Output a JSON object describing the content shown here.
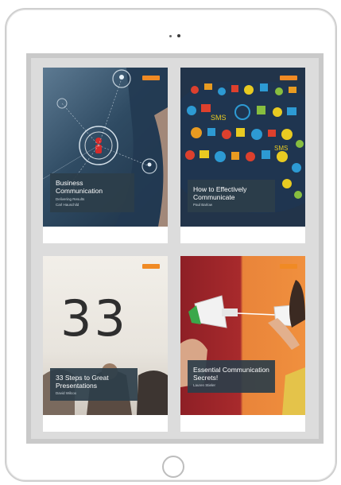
{
  "books": [
    {
      "title": "Business Communication",
      "subtitle": "Delivering Results",
      "author": "Carl Hauschild"
    },
    {
      "title": "How to Effectively Communicate",
      "subtitle": "",
      "author": "Paul Barlow"
    },
    {
      "title": "33 Steps to Great Presentations",
      "subtitle": "",
      "author": "David Wilcox"
    },
    {
      "title": "Essential Communication Secrets!",
      "subtitle": "",
      "author": "Lauren Stieler"
    }
  ],
  "cover_numbers": {
    "steps": "33"
  },
  "colors": {
    "caption_bg": "#2c3e4a",
    "badge": "#f08a24",
    "device_frame": "#cfcfcf",
    "screen_bg": "#c9c9c9"
  },
  "icons": [
    "camera-icon",
    "home-button-icon",
    "publisher-badge-icon"
  ]
}
